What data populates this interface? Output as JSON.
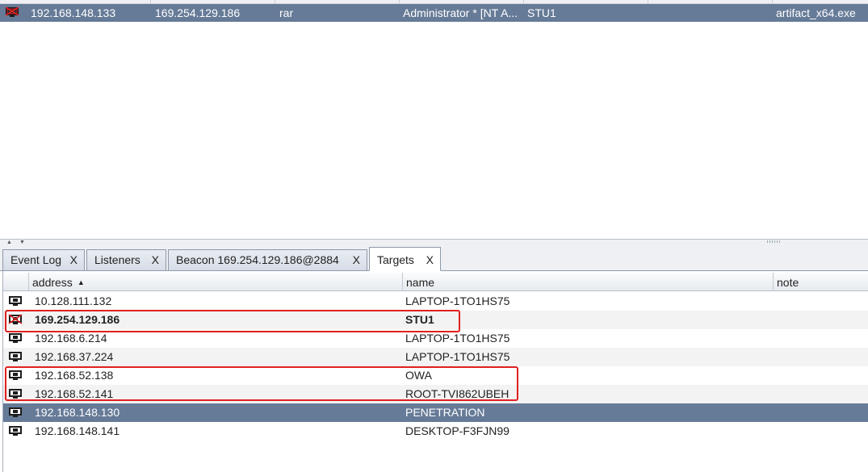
{
  "beacon_table": {
    "row": {
      "external": "192.168.148.133",
      "internal": "169.254.129.186",
      "listener": "rar",
      "user": "Administrator * [NT A...",
      "computer": "STU1",
      "process": "artifact_x64.exe"
    }
  },
  "tabs": [
    {
      "label": "Event Log",
      "close": "X"
    },
    {
      "label": "Listeners",
      "close": "X"
    },
    {
      "label": "Beacon 169.254.129.186@2884",
      "close": "X"
    },
    {
      "label": "Targets",
      "close": "X"
    }
  ],
  "targets": {
    "columns": {
      "address": "address",
      "name": "name",
      "note": "note"
    },
    "sort_indicator": "▲",
    "rows": [
      {
        "address": "10.128.111.132",
        "name": "LAPTOP-1TO1HS75",
        "note": ""
      },
      {
        "address": "169.254.129.186",
        "name": "STU1",
        "note": ""
      },
      {
        "address": "192.168.6.214",
        "name": "LAPTOP-1TO1HS75",
        "note": ""
      },
      {
        "address": "192.168.37.224",
        "name": "LAPTOP-1TO1HS75",
        "note": ""
      },
      {
        "address": "192.168.52.138",
        "name": "OWA",
        "note": ""
      },
      {
        "address": "192.168.52.141",
        "name": "ROOT-TVI862UBEH",
        "note": ""
      },
      {
        "address": "192.168.148.130",
        "name": "PENETRATION",
        "note": ""
      },
      {
        "address": "192.168.148.141",
        "name": "DESKTOP-F3FJN99",
        "note": ""
      }
    ]
  },
  "colors": {
    "selection": "#667b97",
    "highlight_box": "#e02020"
  }
}
